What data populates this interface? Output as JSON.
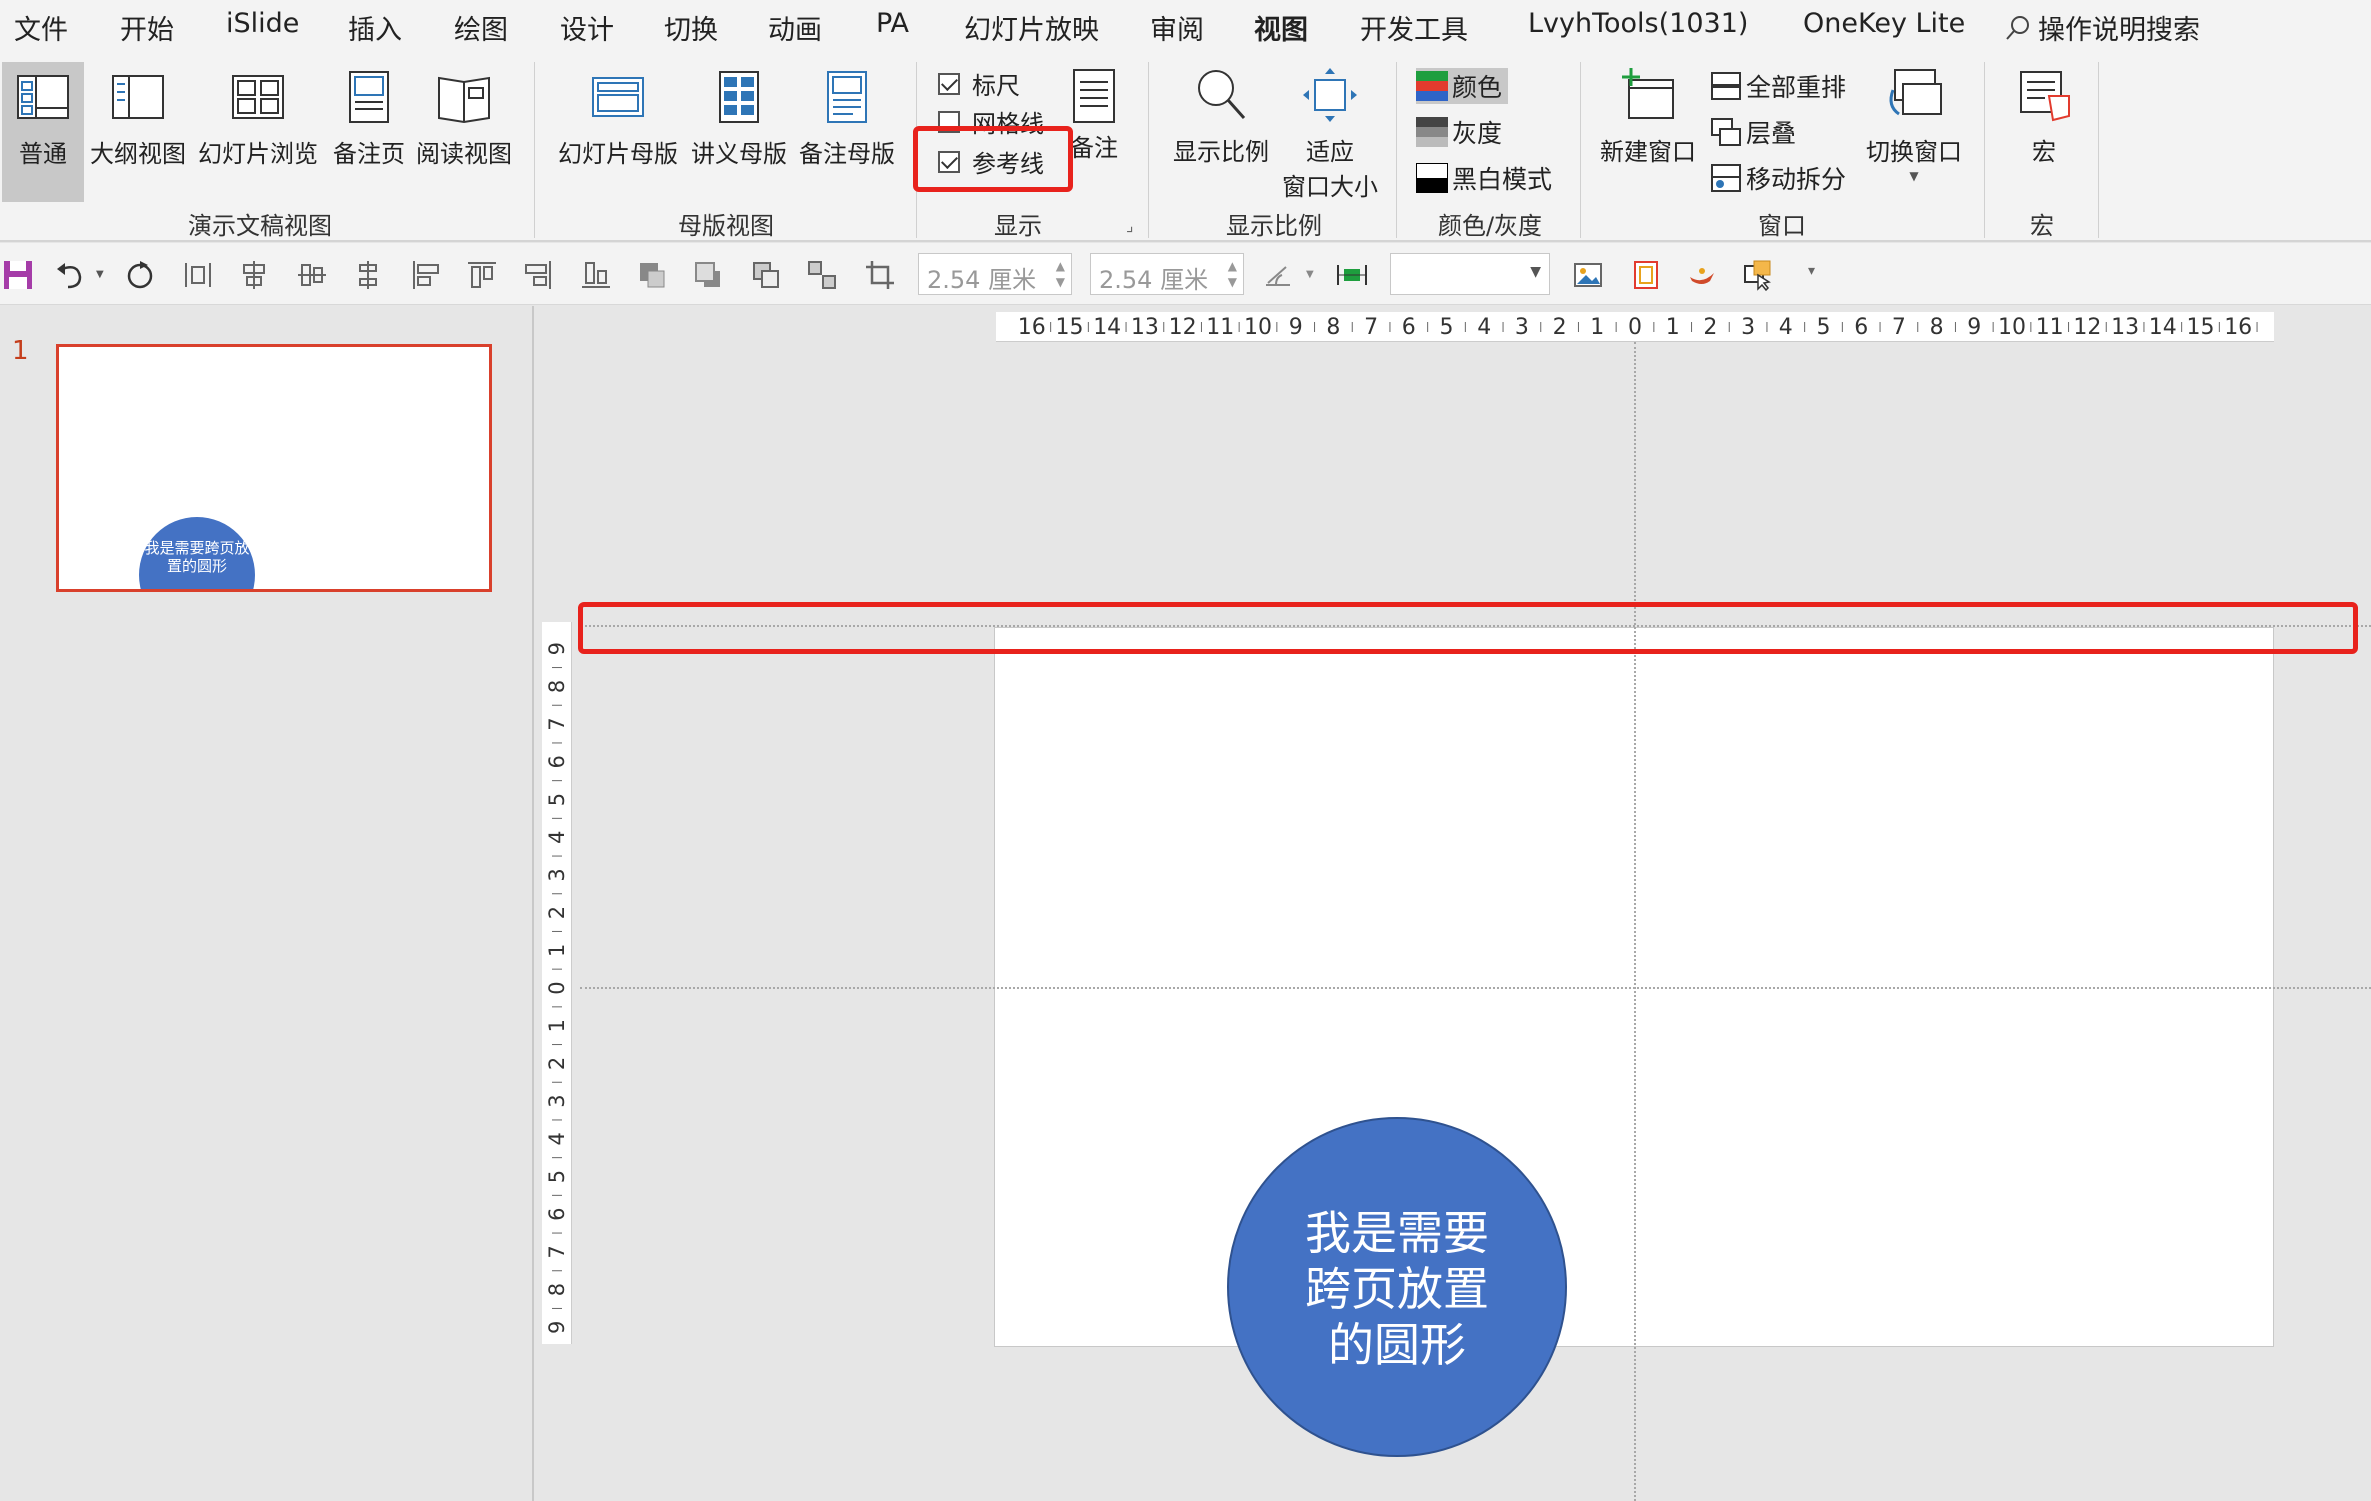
{
  "menu": {
    "tabs": [
      "文件",
      "开始",
      "iSlide",
      "插入",
      "绘图",
      "设计",
      "切换",
      "动画",
      "PA",
      "幻灯片放映",
      "审阅",
      "视图",
      "开发工具",
      "LvyhTools(1031)",
      "OneKey Lite"
    ],
    "active": "视图",
    "search_label": "操作说明搜索"
  },
  "ribbon": {
    "presentation_views": {
      "label": "演示文稿视图",
      "buttons": [
        "普通",
        "大纲视图",
        "幻灯片浏览",
        "备注页",
        "阅读视图"
      ]
    },
    "master_views": {
      "label": "母版视图",
      "buttons": [
        "幻灯片母版",
        "讲义母版",
        "备注母版"
      ]
    },
    "show": {
      "label": "显示",
      "ruler": "标尺",
      "gridlines": "网格线",
      "guides": "参考线",
      "notes": "备注"
    },
    "zoom": {
      "label": "显示比例",
      "zoom_button": "显示比例",
      "fit_line1": "适应",
      "fit_line2": "窗口大小"
    },
    "color": {
      "label": "颜色/灰度",
      "color": "颜色",
      "grayscale": "灰度",
      "bw": "黑白模式"
    },
    "window": {
      "label": "窗口",
      "new_window": "新建窗口",
      "arrange_all": "全部重排",
      "cascade": "层叠",
      "move_split": "移动拆分",
      "switch_window": "切换窗口"
    },
    "macros": {
      "label": "宏",
      "button": "宏"
    }
  },
  "qat": {
    "height_value": "2.54 厘米",
    "width_value": "2.54 厘米"
  },
  "thumbnail": {
    "number": "1",
    "circle_text": "我是需要跨页放置的圆形"
  },
  "slide": {
    "circle_line1": "我是需要",
    "circle_line2": "跨页放置",
    "circle_line3": "的圆形"
  },
  "colors": {
    "accent": "#c43e1c",
    "circle": "#4472c4",
    "highlight": "#e8221c"
  }
}
